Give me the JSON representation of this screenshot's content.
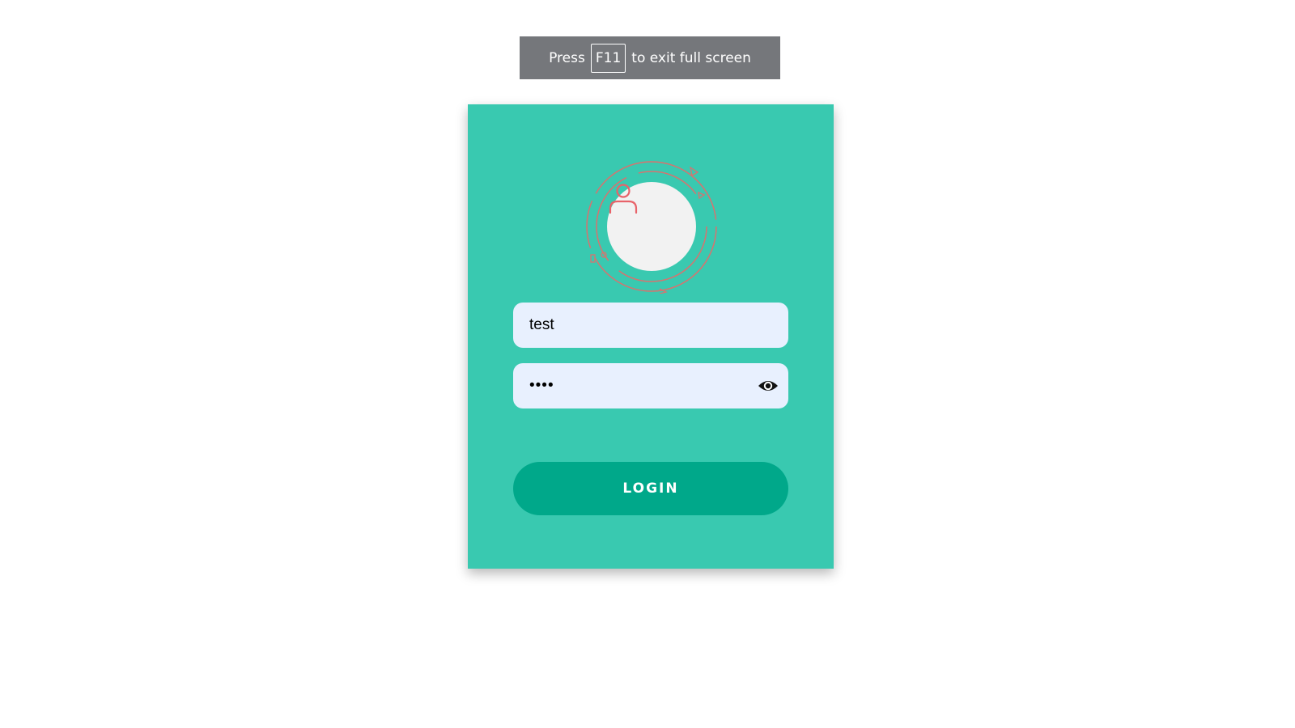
{
  "fullscreen_notice": {
    "prefix": "Press",
    "key": "F11",
    "suffix": "to exit full screen"
  },
  "login_form": {
    "avatar_icon": "user-icon",
    "username": {
      "value": "test",
      "placeholder": ""
    },
    "password": {
      "value": "test",
      "placeholder": "",
      "toggle_icon": "eye-icon"
    },
    "login_label": "LOGIN"
  },
  "colors": {
    "card_background": "#39c9b0",
    "button_background": "#00a88a",
    "input_background": "#e8f0fe",
    "avatar_icon": "#e8636a",
    "notice_background": "#75777b"
  }
}
